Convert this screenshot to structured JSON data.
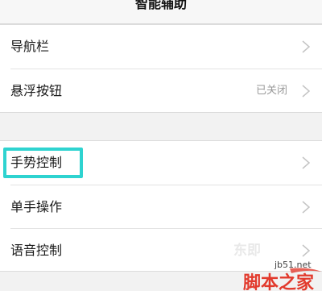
{
  "header": {
    "title": "智能辅助"
  },
  "group1": [
    {
      "label": "导航栏",
      "value": ""
    },
    {
      "label": "悬浮按钮",
      "value": "已关闭"
    }
  ],
  "group2": [
    {
      "label": "手势控制"
    },
    {
      "label": "单手操作"
    },
    {
      "label": "语音控制"
    }
  ],
  "watermark": {
    "url": "jb51.net",
    "brand": "脚本之家",
    "faded": "东即"
  },
  "colors": {
    "highlight": "#2ed3d0",
    "brand": "#e23a2d"
  },
  "icons": {
    "chevron": "chevron-right-icon"
  }
}
